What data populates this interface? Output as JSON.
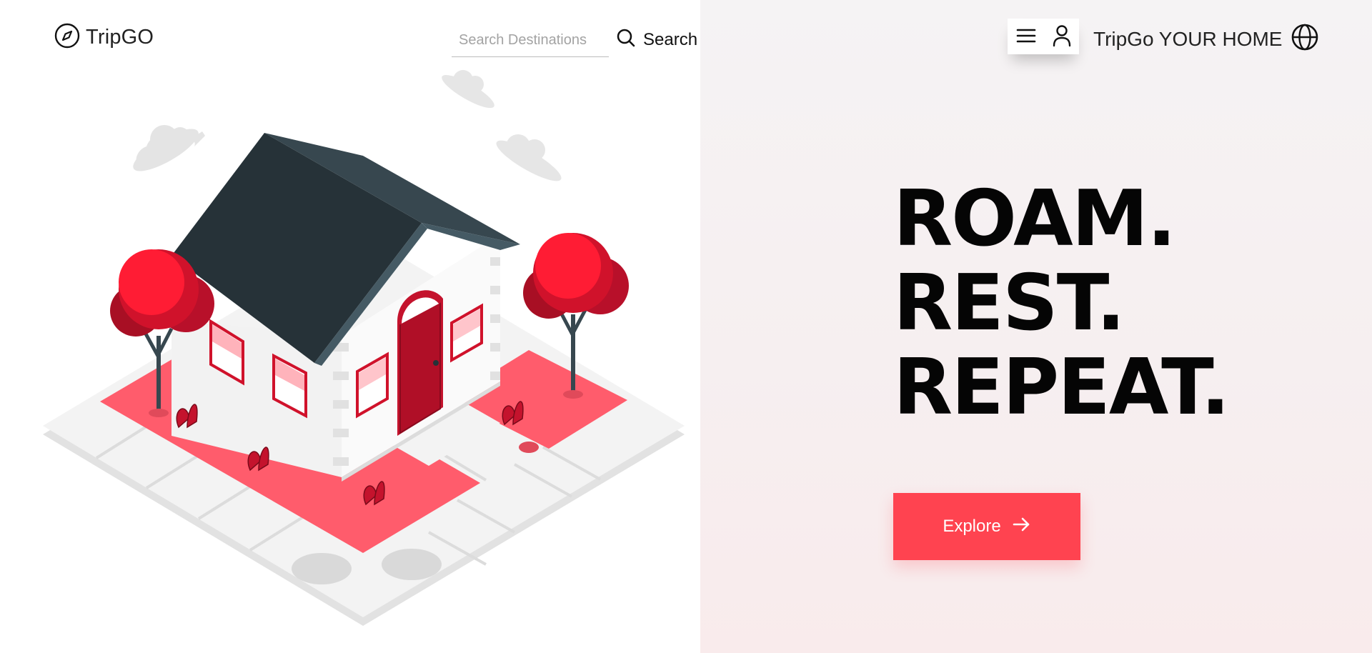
{
  "brand": {
    "name": "TripGO",
    "icon": "compass-icon"
  },
  "search": {
    "placeholder": "Search Destinations",
    "value": "",
    "button_label": "Search",
    "icon": "search-icon"
  },
  "header_right": {
    "menu_icon": "hamburger-menu-icon",
    "user_icon": "user-icon",
    "title": "TripGo YOUR HOME",
    "globe_icon": "globe-icon"
  },
  "hero": {
    "lines": [
      "ROAM.",
      "REST.",
      "REPEAT."
    ]
  },
  "cta": {
    "label": "Explore",
    "icon": "arrow-right-icon"
  },
  "colors": {
    "accent": "#ff4350",
    "tree_red": "#d0122b",
    "roof": "#263238",
    "text": "#050505",
    "right_bg": "#f6f0f1"
  }
}
